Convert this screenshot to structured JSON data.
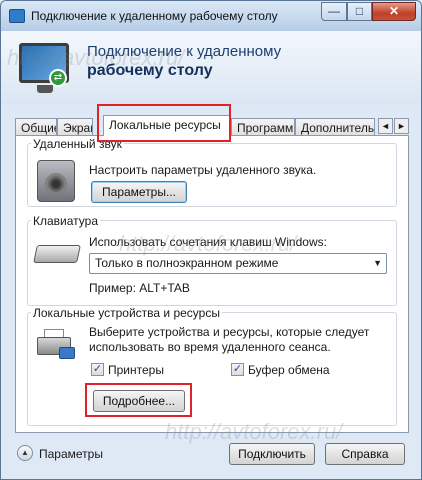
{
  "window": {
    "title": "Подключение к удаленному рабочему столу",
    "minimize": "—",
    "maximize": "□",
    "close": "✕"
  },
  "banner": {
    "line1": "Подключение к удаленному",
    "line2": "рабочему столу"
  },
  "tabs": {
    "general": "Общие",
    "screen": "Экран",
    "local": "Локальные ресурсы",
    "programs": "Программы",
    "extra": "Дополнительно",
    "scroll_left": "◄",
    "scroll_right": "►"
  },
  "sound": {
    "legend": "Удаленный звук",
    "description": "Настроить параметры удаленного звука.",
    "button": "Параметры..."
  },
  "keyboard": {
    "legend": "Клавиатура",
    "description": "Использовать сочетания клавиш Windows:",
    "selected": "Только в полноэкранном режиме",
    "arrow": "▼",
    "example": "Пример: ALT+TAB"
  },
  "devices": {
    "legend": "Локальные устройства и ресурсы",
    "description_line1": "Выберите устройства и ресурсы, которые следует",
    "description_line2": "использовать во время удаленного сеанса.",
    "printers_label": "Принтеры",
    "clipboard_label": "Буфер обмена",
    "check_mark": "✓",
    "more_button": "Подробнее..."
  },
  "footer": {
    "options_label": "Параметры",
    "toggle_glyph": "▲",
    "connect_button": "Подключить",
    "help_button": "Справка"
  },
  "watermark": {
    "text": "http://avtoforex.ru/"
  },
  "colors": {
    "highlight": "#e0222a",
    "banner_title": "#12315e"
  }
}
